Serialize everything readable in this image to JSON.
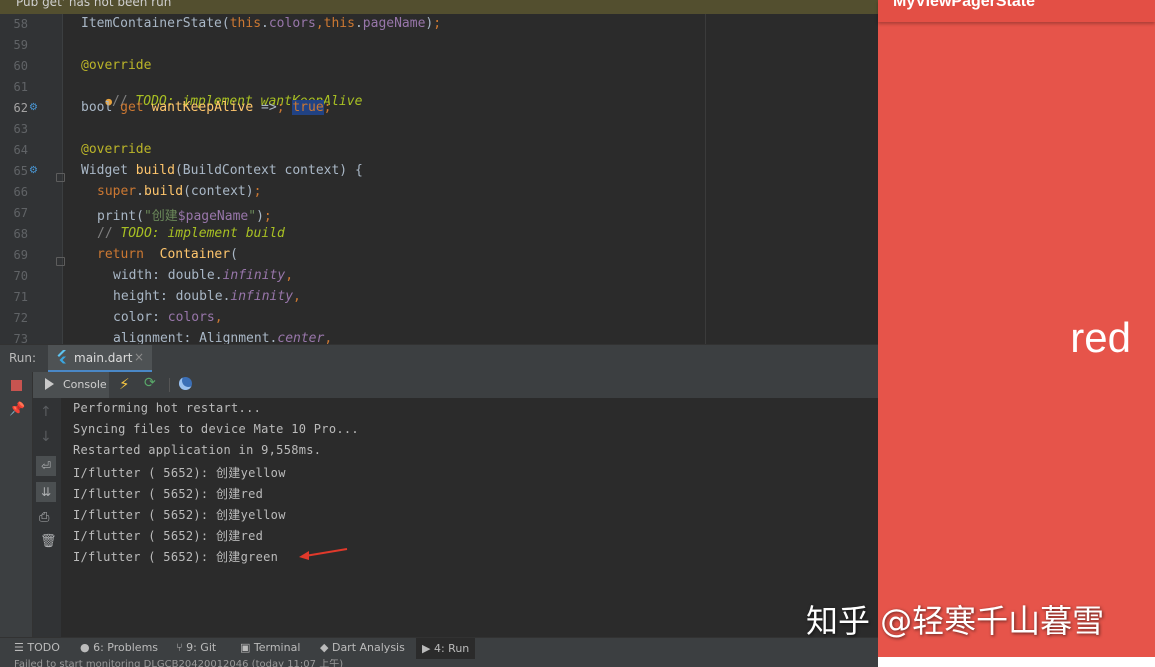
{
  "banner": {
    "text": "Pub get' has not been run"
  },
  "editor": {
    "lines": [
      {
        "n": "58",
        "text": "ItemContainerState(this.colors,this.pageName);"
      },
      {
        "n": "59",
        "text": ""
      },
      {
        "n": "60",
        "text": "@override"
      },
      {
        "n": "61",
        "text": "// TODO: implement wantKeepAlive"
      },
      {
        "n": "62",
        "text": "bool get wantKeepAlive => true;"
      },
      {
        "n": "63",
        "text": ""
      },
      {
        "n": "64",
        "text": "@override"
      },
      {
        "n": "65",
        "text": "Widget build(BuildContext context) {"
      },
      {
        "n": "66",
        "text": "super.build(context);"
      },
      {
        "n": "67",
        "text": "print(\"创建$pageName\");"
      },
      {
        "n": "68",
        "text": "// TODO: implement build"
      },
      {
        "n": "69",
        "text": "return  Container("
      },
      {
        "n": "70",
        "text": "width: double.infinity,"
      },
      {
        "n": "71",
        "text": "height: double.infinity,"
      },
      {
        "n": "72",
        "text": "color: colors,"
      },
      {
        "n": "73",
        "text": "alignment: Alignment.center,"
      }
    ]
  },
  "run": {
    "title": "Run:",
    "tab_label": "main.dart",
    "tab_close": "×",
    "console_label": "Console",
    "output": [
      "Performing hot restart...",
      "Syncing files to device Mate 10 Pro...",
      "Restarted application in 9,558ms.",
      "I/flutter ( 5652): 创建yellow",
      "I/flutter ( 5652): 创建red",
      "I/flutter ( 5652): 创建yellow",
      "I/flutter ( 5652): 创建red",
      "I/flutter ( 5652): 创建green"
    ]
  },
  "bottom_tabs": {
    "todo": "TODO",
    "problems": "6: Problems",
    "git": "9: Git",
    "terminal": "Terminal",
    "dart": "Dart Analysis",
    "run": "4: Run"
  },
  "status": {
    "text": "Failed to start monitoring DLGCB20420012046 (today 11:07 上午)"
  },
  "phone": {
    "app_title": "MyViewPagerState",
    "page_text": "red",
    "background": "#e6544a"
  },
  "watermark": {
    "text": "知乎 @轻寒千山暮雪"
  },
  "colors": {
    "editor_bg": "#2b2b2b",
    "panel_bg": "#3c3f41",
    "keyword": "#cc7832",
    "annotation": "#bbb529",
    "string": "#6a8759",
    "todo": "#a8c023",
    "arrow": "#e0392b"
  }
}
